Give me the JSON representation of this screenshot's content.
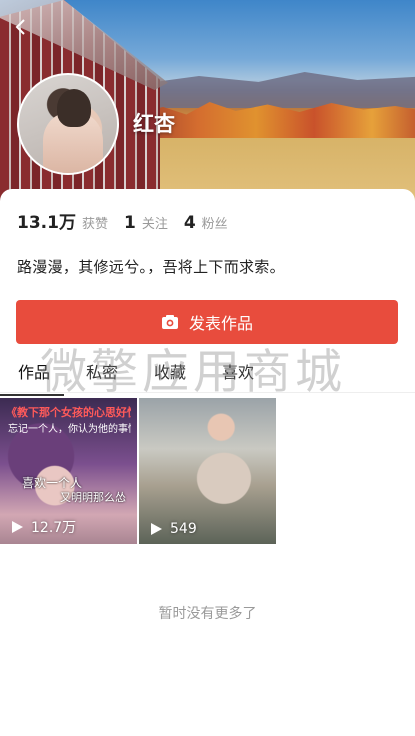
{
  "profile": {
    "name": "红杏",
    "bio": "路漫漫，其修远兮。，吾将上下而求索。"
  },
  "icons": {
    "back": "chevron-left-icon",
    "camera": "camera-icon",
    "play": "play-icon"
  },
  "stats": [
    {
      "value": "13.1万",
      "label": "获赞"
    },
    {
      "value": "1",
      "label": "关注"
    },
    {
      "value": "4",
      "label": "粉丝"
    }
  ],
  "actions": {
    "publish_label": "发表作品"
  },
  "tabs": [
    {
      "label": "作品",
      "active": true
    },
    {
      "label": "私密",
      "active": false
    },
    {
      "label": "收藏",
      "active": false
    },
    {
      "label": "喜欢",
      "active": false
    }
  ],
  "watermark": "微擎应用商城",
  "posts": [
    {
      "title": "《教下那个女孩的心思好懂人》",
      "subtitle": "忘记一个人，你认为他的事情呢？",
      "caption1": "喜欢一个人",
      "caption2": "又明明那么怂",
      "plays": "12.7万"
    },
    {
      "plays": "549"
    }
  ],
  "footer": {
    "no_more": "暂时没有更多了"
  },
  "colors": {
    "accent": "#e84c3d",
    "text": "#222222",
    "muted": "#9a9a9a"
  }
}
